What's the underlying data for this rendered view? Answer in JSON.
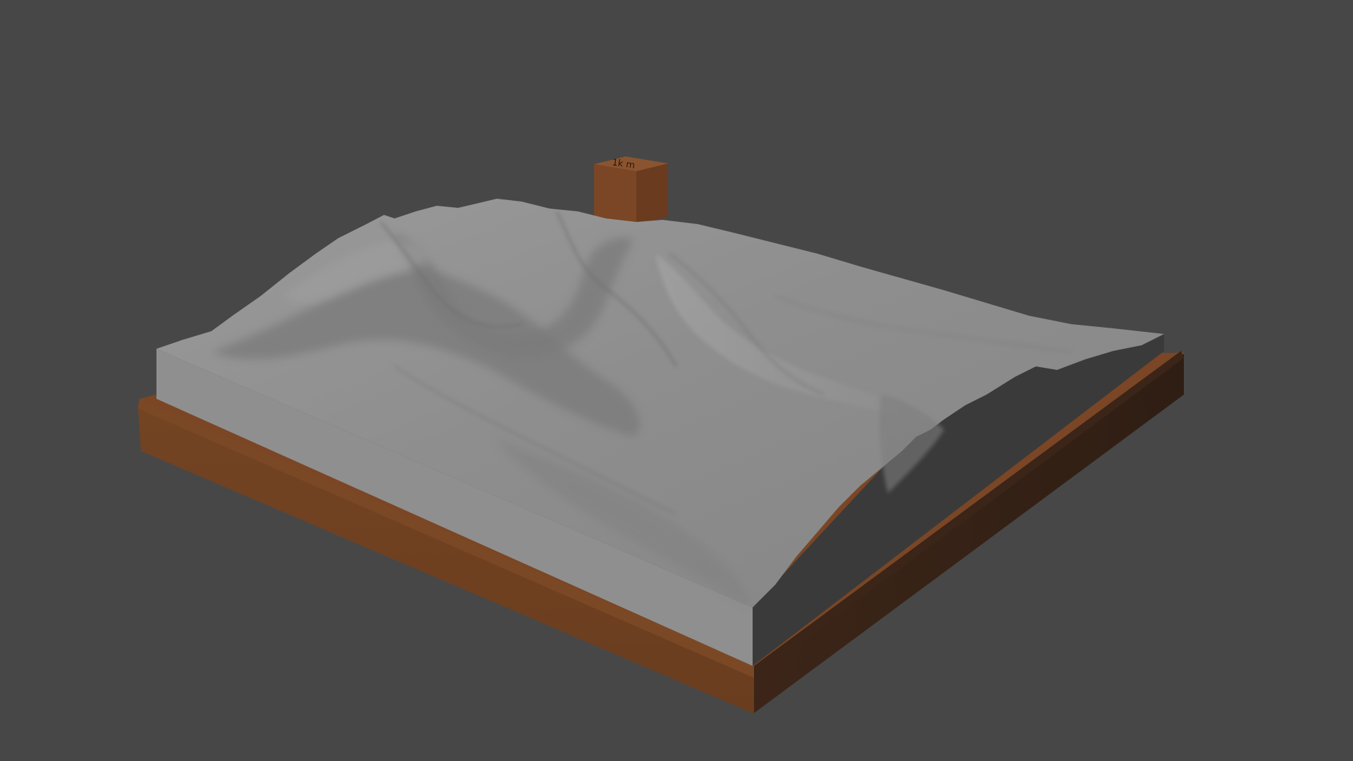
{
  "scene": {
    "background_color": "#474747",
    "terrain_color": "#8a8a8a",
    "terrain_side_color": "#7d7d7d",
    "base_color": "#6e4021",
    "base_shadow_color": "#3a2418",
    "label_block_color": "#7a4524",
    "label_text": "1k m"
  }
}
